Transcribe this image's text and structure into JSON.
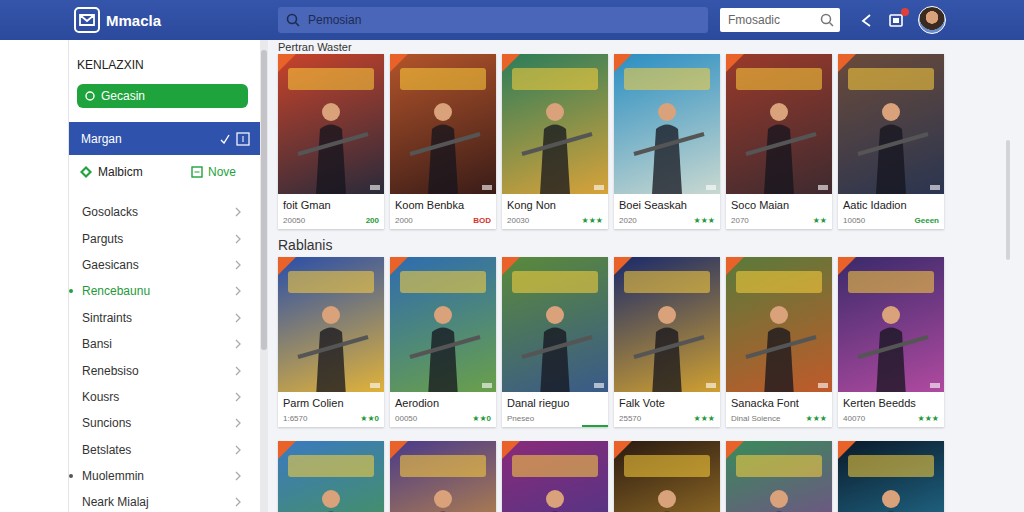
{
  "app": {
    "logo_text": "Mmacla"
  },
  "topbar": {
    "search_placeholder": "Pemosian",
    "quick_search_placeholder": "Fmosadic",
    "notification": true
  },
  "sidebar": {
    "heading": "KENLAZXIN",
    "button": "Gecasin",
    "active": {
      "label": "Margan",
      "selected": true
    },
    "sub": {
      "left": "Malbicm",
      "right": "Nove"
    },
    "items": [
      {
        "label": "Gosolacks",
        "selected": false,
        "dot": false
      },
      {
        "label": "Parguts",
        "selected": false,
        "dot": false
      },
      {
        "label": "Gaesicans",
        "selected": false,
        "dot": false
      },
      {
        "label": "Rencebaunu",
        "selected": true,
        "dot": true
      },
      {
        "label": "Sintraints",
        "selected": false,
        "dot": false
      },
      {
        "label": "Bansi",
        "selected": false,
        "dot": false
      },
      {
        "label": "Renebsiso",
        "selected": false,
        "dot": false
      },
      {
        "label": "Kousrs",
        "selected": false,
        "dot": false
      },
      {
        "label": "Suncions",
        "selected": false,
        "dot": false
      },
      {
        "label": "Betslates",
        "selected": false,
        "dot": false
      },
      {
        "label": "Muolemmin",
        "selected": false,
        "dot": true
      },
      {
        "label": "Neark Mialaj",
        "selected": false,
        "dot": false
      }
    ]
  },
  "sections": [
    {
      "title": "Pertran Waster",
      "cards": [
        {
          "title": "foit Gman",
          "meta": "20050",
          "badge": "200",
          "color": "#1f9a3a"
        },
        {
          "title": "Koom Benbka",
          "meta": "2000",
          "badge": "BOD",
          "color": "#d8322b"
        },
        {
          "title": "Kong Non",
          "meta": "20030",
          "badge": "★★★",
          "color": "#1f9a3a"
        },
        {
          "title": "Boei Seaskah",
          "meta": "2020",
          "badge": "★★★",
          "color": "#1f9a3a"
        },
        {
          "title": "Soco Maian",
          "meta": "2070",
          "badge": "★★",
          "color": "#1f9a3a"
        },
        {
          "title": "Aatic Idadion",
          "meta": "10050",
          "badge": "Geeen",
          "color": "#1f9a3a"
        }
      ]
    },
    {
      "title": "Rablanis",
      "cards": [
        {
          "title": "Parm Colien",
          "meta": "1:6570",
          "badge": "★★0",
          "color": "#1f9a3a"
        },
        {
          "title": "Aerodion",
          "meta": "00050",
          "badge": "★★0",
          "color": "#1f9a3a"
        },
        {
          "title": "Danal rieguo",
          "meta": "Pneseo",
          "badge": "",
          "color": "#1f9a3a",
          "level": 0.25
        },
        {
          "title": "Falk Vote",
          "meta": "25570",
          "badge": "★★★",
          "color": "#1f9a3a"
        },
        {
          "title": "Sanacka Font",
          "meta": "Dinal Soience",
          "badge": "★★★",
          "color": "#1f9a3a"
        },
        {
          "title": "Kerten Beedds",
          "meta": "40070",
          "badge": "★★★",
          "color": "#1f9a3a"
        }
      ]
    }
  ]
}
